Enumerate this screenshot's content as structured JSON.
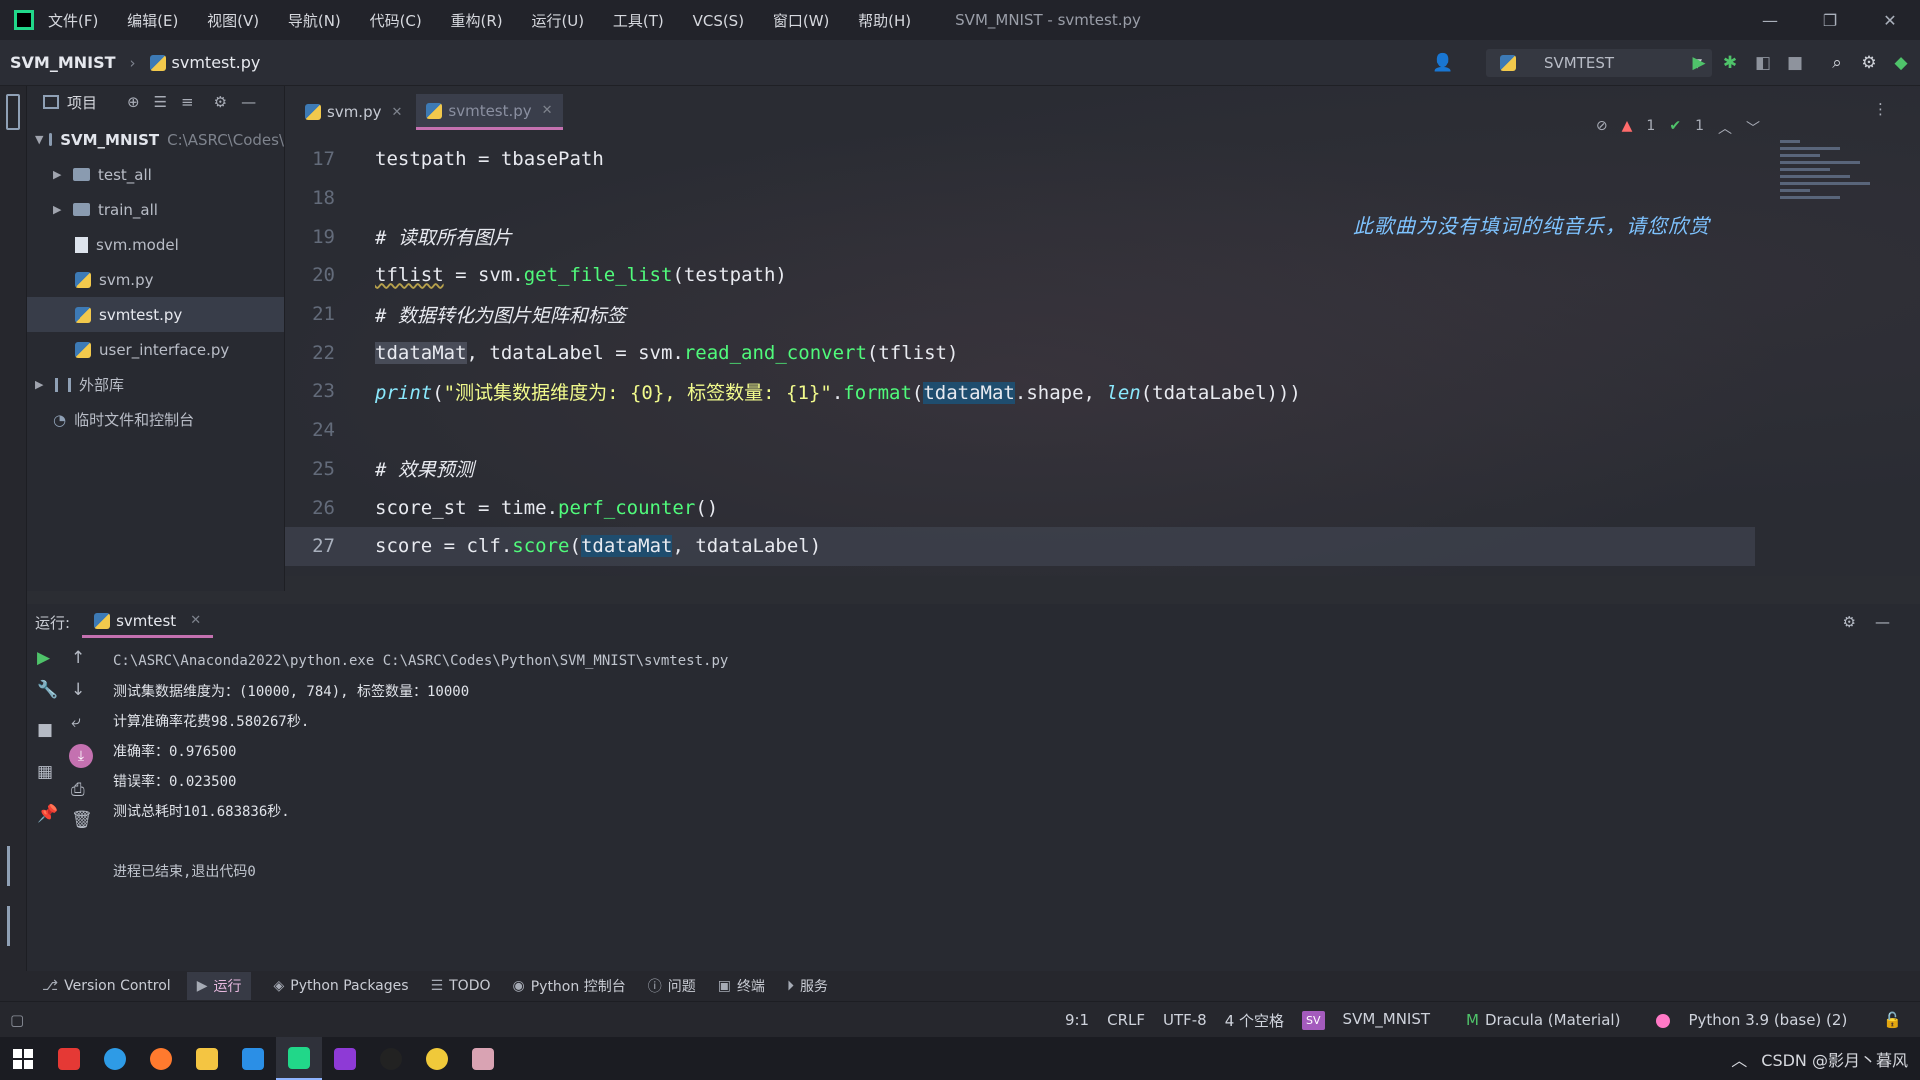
{
  "titlebar": {
    "menu": [
      "文件(F)",
      "编辑(E)",
      "视图(V)",
      "导航(N)",
      "代码(C)",
      "重构(R)",
      "运行(U)",
      "工具(T)",
      "VCS(S)",
      "窗口(W)",
      "帮助(H)"
    ],
    "window_title": "SVM_MNIST - svmtest.py",
    "controls": [
      "—",
      "❐",
      "✕"
    ]
  },
  "navbar": {
    "project": "SVM_MNIST",
    "file": "svmtest.py",
    "run_config": "SVMTEST"
  },
  "project_panel": {
    "title": "项目",
    "items": [
      {
        "label": "SVM_MNIST",
        "extra": "C:\\ASRC\\Codes\\"
      },
      {
        "label": "test_all"
      },
      {
        "label": "train_all"
      },
      {
        "label": "svm.model"
      },
      {
        "label": "svm.py"
      },
      {
        "label": "svmtest.py"
      },
      {
        "label": "user_interface.py"
      },
      {
        "label": "外部库"
      },
      {
        "label": "临时文件和控制台"
      }
    ]
  },
  "editor": {
    "tabs": [
      {
        "label": "svm.py"
      },
      {
        "label": "svmtest.py"
      }
    ],
    "lyric": "此歌曲为没有填词的纯音乐，请您欣赏",
    "inspections": {
      "warnings": "1",
      "ok": "1"
    },
    "line_numbers": [
      "17",
      "18",
      "19",
      "20",
      "21",
      "22",
      "23",
      "24",
      "25",
      "26",
      "27"
    ],
    "code": {
      "l17": "testpath = tbasePath",
      "l19": "# 读取所有图片",
      "l20_a": "tflist",
      "l20_b": " = svm.",
      "l20_fn": "get_file_list",
      "l20_c": "(testpath)",
      "l21": "# 数据转化为图片矩阵和标签",
      "l22_a": "tdataMat",
      "l22_b": ", tdataLabel = svm.",
      "l22_fn": "read_and_convert",
      "l22_c": "(tflist)",
      "l23_print": "print",
      "l23_p": "(",
      "l23_str": "\"测试集数据维度为: {0}, 标签数量: {1}\"",
      "l23_dot": ".",
      "l23_fmt": "format",
      "l23_p2": "(",
      "l23_hl": "tdataMat",
      "l23_mid": ".shape, ",
      "l23_len": "len",
      "l23_end": "(tdataLabel)))",
      "l25": "# 效果预测",
      "l26_a": "score_st = time.",
      "l26_fn": "perf_counter",
      "l26_c": "()",
      "l27_a": "score = clf.",
      "l27_fn": "score",
      "l27_p": "(",
      "l27_hl": "tdataMat",
      "l27_c": ", tdataLabel)"
    }
  },
  "run_panel": {
    "label": "运行:",
    "tab": "svmtest",
    "output": [
      "C:\\ASRC\\Anaconda2022\\python.exe C:\\ASRC\\Codes\\Python\\SVM_MNIST\\svmtest.py",
      "测试集数据维度为：(10000, 784), 标签数量：10000",
      "计算准确率花费98.580267秒.",
      "准确率：0.976500",
      "错误率：0.023500",
      "测试总耗时101.683836秒.",
      "",
      "进程已结束,退出代码0"
    ]
  },
  "tool_tabs": [
    "Version Control",
    "运行",
    "Python Packages",
    "TODO",
    "Python 控制台",
    "问题",
    "终端",
    "服务"
  ],
  "statusbar": {
    "position": "9:1",
    "line_sep": "CRLF",
    "encoding": "UTF-8",
    "indent": "4 个空格",
    "sv_badge": "SV",
    "project": "SVM_MNIST",
    "theme": "Dracula (Material)",
    "interpreter": "Python 3.9 (base) (2)"
  },
  "taskbar": {
    "tray": "CSDN @影月丶暮风"
  },
  "colors": {
    "accent": "#c471b0",
    "keyword_fn": "#50fa7b",
    "string": "#f1fa8c",
    "builtin": "#8be9fd",
    "comment": "#7b8496"
  }
}
